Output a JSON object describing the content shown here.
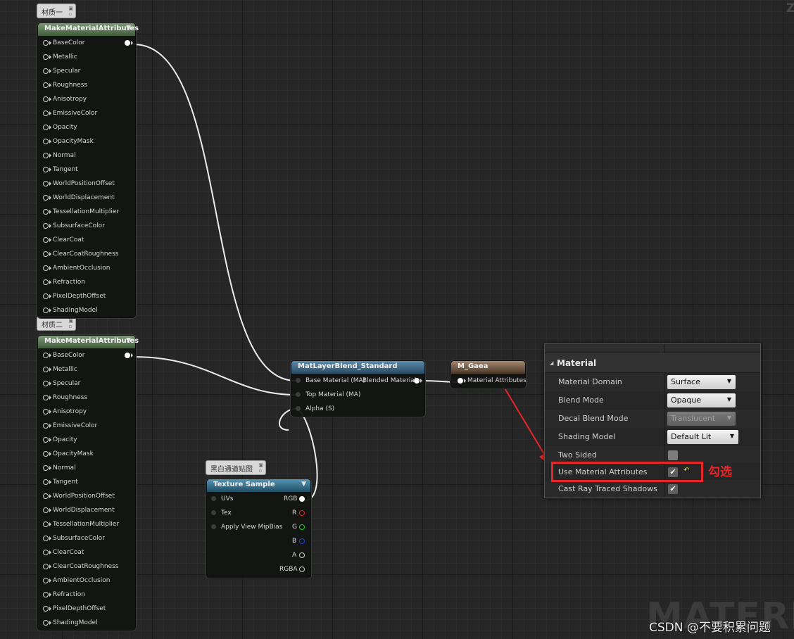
{
  "comments": {
    "material_one": "材质一",
    "material_two": "材质二",
    "bw_map": "黑白通道贴图"
  },
  "make_material_attributes_node": {
    "title": "MakeMaterialAttributes",
    "pins": [
      "BaseColor",
      "Metallic",
      "Specular",
      "Roughness",
      "Anisotropy",
      "EmissiveColor",
      "Opacity",
      "OpacityMask",
      "Normal",
      "Tangent",
      "WorldPositionOffset",
      "WorldDisplacement",
      "TessellationMultiplier",
      "SubsurfaceColor",
      "ClearCoat",
      "ClearCoatRoughness",
      "AmbientOcclusion",
      "Refraction",
      "PixelDepthOffset",
      "ShadingModel"
    ]
  },
  "mat_layer_blend_node": {
    "title": "MatLayerBlend_Standard",
    "inputs": [
      "Base Material (MA)",
      "Top Material (MA)",
      "Alpha (S)"
    ],
    "output": "Blended Material"
  },
  "m_gaea_node": {
    "title": "M_Gaea",
    "input": "Material Attributes"
  },
  "texture_sample_node": {
    "title": "Texture Sample",
    "inputs": [
      "UVs",
      "Tex",
      "Apply View MipBias"
    ],
    "outputs": [
      "RGB",
      "R",
      "G",
      "B",
      "A",
      "RGBA"
    ]
  },
  "details_panel": {
    "category": "Material",
    "material_domain": {
      "label": "Material Domain",
      "value": "Surface"
    },
    "blend_mode": {
      "label": "Blend Mode",
      "value": "Opaque"
    },
    "decal_blend_mode": {
      "label": "Decal Blend Mode",
      "value": "Translucent"
    },
    "shading_model": {
      "label": "Shading Model",
      "value": "Default Lit"
    },
    "two_sided": {
      "label": "Two Sided",
      "checked": false
    },
    "use_material_attributes": {
      "label": "Use Material Attributes",
      "checked": true
    },
    "cast_ray_traced_shadows": {
      "label": "Cast Ray Traced Shadows",
      "checked": true
    }
  },
  "annotation": "勾选",
  "background_word": "MATERIA",
  "corner_letter": "Z",
  "watermark": "CSDN @不要积累问题",
  "colors": {
    "graph_background": "#262626",
    "annotation_red": "#e8262a",
    "pin_red": "#e02020",
    "pin_green": "#20d020",
    "pin_blue": "#2040e0"
  }
}
